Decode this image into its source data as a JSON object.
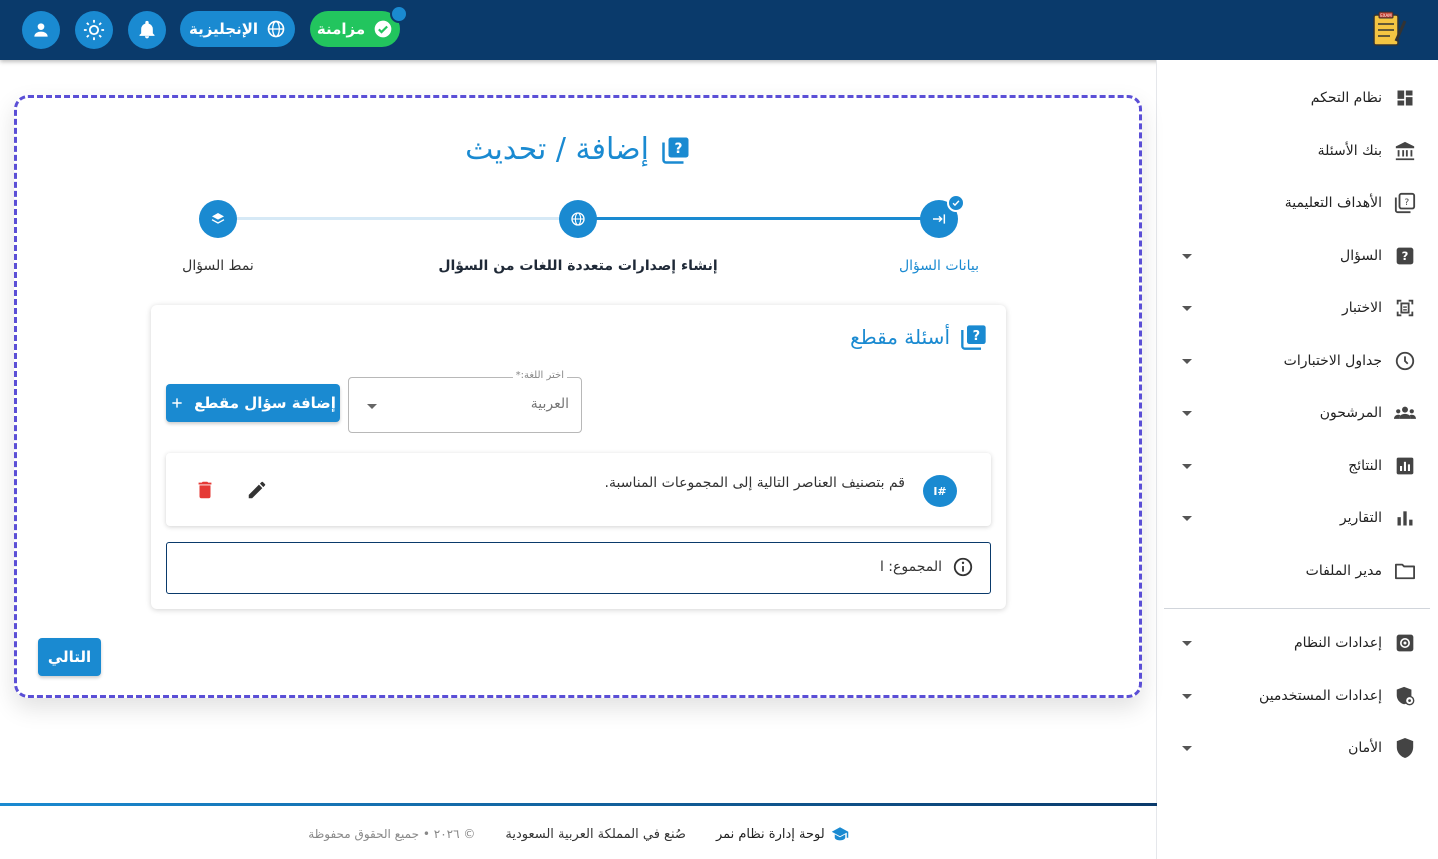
{
  "header": {
    "sync_label": "مزامنة",
    "language_label": "الإنجليزية"
  },
  "sidebar": {
    "items": [
      {
        "label": "نظام التحكم",
        "icon": "dashboard-icon",
        "caret": false
      },
      {
        "label": "بنك الأسئلة",
        "icon": "bank-icon",
        "caret": false
      },
      {
        "label": "الأهداف التعليمية",
        "icon": "objectives-icon",
        "caret": false
      },
      {
        "label": "السؤال",
        "icon": "question-icon",
        "caret": true
      },
      {
        "label": "الاختبار",
        "icon": "exam-icon",
        "caret": true
      },
      {
        "label": "جداول الاختبارات",
        "icon": "clock-icon",
        "caret": true
      },
      {
        "label": "المرشحون",
        "icon": "candidates-icon",
        "caret": true
      },
      {
        "label": "النتائج",
        "icon": "results-icon",
        "caret": true
      },
      {
        "label": "التقارير",
        "icon": "reports-icon",
        "caret": true
      },
      {
        "label": "مدير الملفات",
        "icon": "folder-icon",
        "caret": false
      },
      {
        "label": "إعدادات النظام",
        "icon": "settings-icon",
        "caret": true
      },
      {
        "label": "إعدادات المستخدمين",
        "icon": "user-settings-icon",
        "caret": true
      },
      {
        "label": "الأمان",
        "icon": "shield-icon",
        "caret": true
      }
    ]
  },
  "page": {
    "title": "إضافة / تحديث"
  },
  "stepper": {
    "steps": [
      {
        "label": "بيانات السؤال",
        "state": "done"
      },
      {
        "label": "إنشاء إصدارات متعددة اللغات من السؤال",
        "state": "active"
      },
      {
        "label": "نمط السؤال",
        "state": "pending"
      }
    ]
  },
  "card": {
    "title": "أسئلة مقطع",
    "language_select": {
      "label": "اختر اللغة:*",
      "value": "العربية"
    },
    "add_button": "إضافة سؤال مقطع",
    "question": {
      "badge": "I#",
      "text": "قم بتصنيف العناصر التالية إلى المجموعات المناسبة."
    },
    "group": {
      "text": "المجموع: ا"
    }
  },
  "next_button": "التالي",
  "footer": {
    "brand": "لوحة إدارة نظام نمر",
    "made_in": "صُنع في المملكة العربية السعودية",
    "copyright": "© ٢٠٢٦ • جميع الحقوق محفوظة"
  },
  "colors": {
    "header_bg": "#0a3a6b",
    "accent": "#1a8ad1",
    "sync_green": "#22c55e",
    "frame_dash": "#5b4fd6",
    "delete_red": "#e53935"
  }
}
